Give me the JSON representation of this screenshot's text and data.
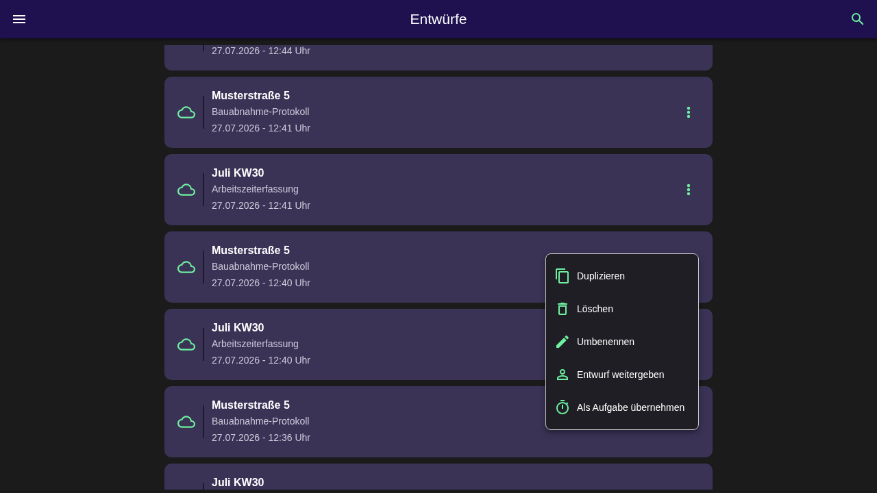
{
  "app_bar": {
    "title": "Entwürfe"
  },
  "drafts": [
    {
      "date": "27.07.2026 - 12:44 Uhr"
    },
    {
      "title": "Musterstraße 5",
      "type": "Bauabnahme-Protokoll",
      "date": "27.07.2026 - 12:41 Uhr",
      "more_button": true
    },
    {
      "title": "Juli KW30",
      "type": "Arbeitszeiterfassung",
      "date": "27.07.2026 - 12:41 Uhr",
      "more_button": true
    },
    {
      "title": "Musterstraße 5",
      "type": "Bauabnahme-Protokoll",
      "date": "27.07.2026 - 12:40 Uhr"
    },
    {
      "title": "Juli KW30",
      "type": "Arbeitszeiterfassung",
      "date": "27.07.2026 - 12:40 Uhr"
    },
    {
      "title": "Musterstraße 5",
      "type": "Bauabnahme-Protokoll",
      "date": "27.07.2026 - 12:36 Uhr"
    },
    {
      "title": "Juli KW30"
    }
  ],
  "context_menu": [
    {
      "kind": "copy",
      "label": "Duplizieren"
    },
    {
      "kind": "delete",
      "label": "Löschen"
    },
    {
      "kind": "rename",
      "label": "Umbenennen"
    },
    {
      "kind": "share",
      "label": "Entwurf weitergeben"
    },
    {
      "kind": "task",
      "label": "Als Aufgabe übernehmen"
    }
  ]
}
